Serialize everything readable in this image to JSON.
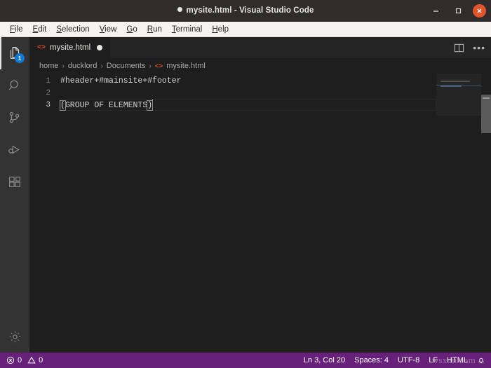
{
  "window": {
    "title": "mysite.html - Visual Studio Code",
    "dirty_indicator": "●",
    "controls": {
      "minimize": "minimize-button",
      "maximize": "maximize-button",
      "close": "close-button"
    }
  },
  "menubar": {
    "items": [
      {
        "label": "File",
        "mnemonic": "F"
      },
      {
        "label": "Edit",
        "mnemonic": "E"
      },
      {
        "label": "Selection",
        "mnemonic": "S"
      },
      {
        "label": "View",
        "mnemonic": "V"
      },
      {
        "label": "Go",
        "mnemonic": "G"
      },
      {
        "label": "Run",
        "mnemonic": "R"
      },
      {
        "label": "Terminal",
        "mnemonic": "T"
      },
      {
        "label": "Help",
        "mnemonic": "H"
      }
    ]
  },
  "activitybar": {
    "items": [
      {
        "name": "explorer",
        "icon": "files-icon",
        "badge": "1",
        "active": true
      },
      {
        "name": "search",
        "icon": "search-icon",
        "badge": "",
        "active": false
      },
      {
        "name": "source-control",
        "icon": "git-branch-icon",
        "badge": "",
        "active": false
      },
      {
        "name": "run-and-debug",
        "icon": "run-debug-icon",
        "badge": "",
        "active": false
      },
      {
        "name": "extensions",
        "icon": "extensions-icon",
        "badge": "",
        "active": false
      }
    ],
    "bottom": [
      {
        "name": "manage-settings",
        "icon": "gear-icon"
      }
    ]
  },
  "editor": {
    "tab": {
      "filename": "mysite.html",
      "file_icon": "<>",
      "dirty": true
    },
    "actions": {
      "split_editor": "split-editor-icon",
      "more_actions": "•••"
    },
    "breadcrumb": {
      "segments": [
        "home",
        "ducklord",
        "Documents",
        "mysite.html"
      ],
      "separator": "›",
      "file_icon": "<>"
    },
    "lines": [
      {
        "number": "1",
        "text": "#header+#mainsite+#footer",
        "current": false
      },
      {
        "number": "2",
        "text": "",
        "current": false
      },
      {
        "number": "3",
        "text": "(GROUP OF ELEMENTS)",
        "current": true
      }
    ],
    "line3_parts": {
      "open_bracket": "(",
      "content": "GROUP OF ELEMENTS",
      "close_bracket": ")"
    }
  },
  "statusbar": {
    "problems": {
      "errors_icon": "error-circle-icon",
      "errors": "0",
      "warnings_icon": "warning-triangle-icon",
      "warnings": "0"
    },
    "right": {
      "cursor_position": "Ln 3, Col 20",
      "indentation": "Spaces: 4",
      "encoding": "UTF-8",
      "eol": "LF",
      "language": "HTML",
      "notifications_icon": "bell-icon"
    },
    "watermark": "wsxdn.com"
  },
  "colors": {
    "titlebar_bg": "#2f2c2b",
    "menubar_bg": "#f5f4f2",
    "activitybar_bg": "#333333",
    "editor_bg": "#1e1e1e",
    "tabbar_bg": "#252526",
    "statusbar_bg": "#68217a",
    "badge_bg": "#0e7ad4",
    "html_icon": "#e44d26",
    "close_btn": "#e2552c"
  }
}
